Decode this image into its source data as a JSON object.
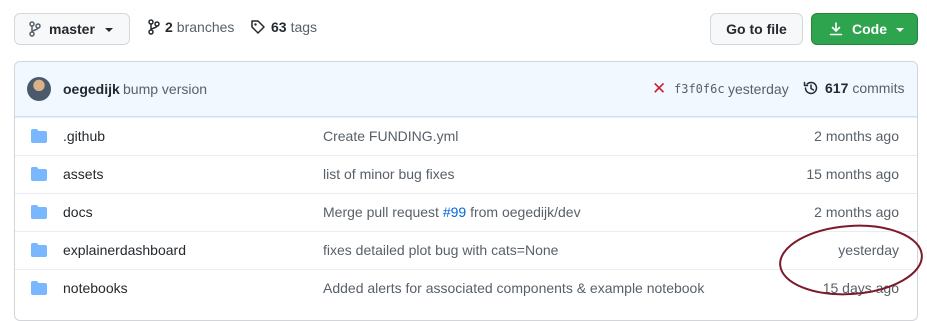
{
  "toolbar": {
    "branch_label": "master",
    "branches_count": "2",
    "branches_label": "branches",
    "tags_count": "63",
    "tags_label": "tags",
    "go_to_file_label": "Go to file",
    "code_label": "Code"
  },
  "latest_commit": {
    "author": "oegedijk",
    "message": "bump version",
    "sha": "f3f0f6c",
    "time": "yesterday",
    "commits_count": "617",
    "commits_label": "commits"
  },
  "files": [
    {
      "name": ".github",
      "message": "Create FUNDING.yml",
      "age": "2 months ago"
    },
    {
      "name": "assets",
      "message": "list of minor bug fixes",
      "age": "15 months ago"
    },
    {
      "name": "docs",
      "message_prefix": "Merge pull request ",
      "message_link": "#99",
      "message_suffix": " from oegedijk/dev",
      "age": "2 months ago"
    },
    {
      "name": "explainerdashboard",
      "message": "fixes detailed plot bug with cats=None",
      "age": "yesterday"
    },
    {
      "name": "notebooks",
      "message": "Added alerts for associated components & example notebook",
      "age": "15 days ago"
    }
  ],
  "colors": {
    "primary_green": "#2ea44f",
    "folder_blue": "#79b8ff",
    "link_blue": "#0366d6",
    "fail_red": "#cb2431",
    "annotation": "#7b1a2a"
  }
}
